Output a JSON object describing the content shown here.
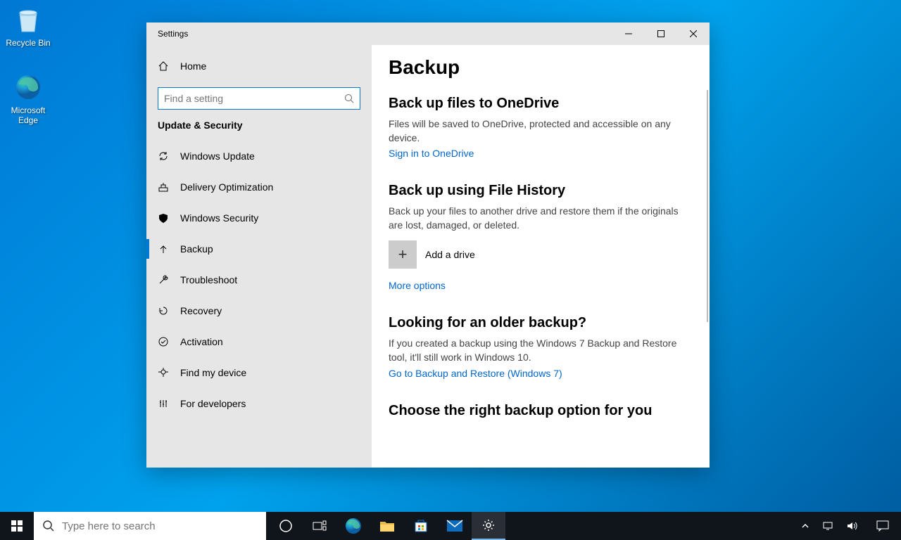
{
  "desktop": {
    "recycle_bin": "Recycle Bin",
    "edge": "Microsoft Edge"
  },
  "window": {
    "title": "Settings"
  },
  "sidebar": {
    "home": "Home",
    "search_placeholder": "Find a setting",
    "category": "Update & Security",
    "items": [
      {
        "label": "Windows Update"
      },
      {
        "label": "Delivery Optimization"
      },
      {
        "label": "Windows Security"
      },
      {
        "label": "Backup"
      },
      {
        "label": "Troubleshoot"
      },
      {
        "label": "Recovery"
      },
      {
        "label": "Activation"
      },
      {
        "label": "Find my device"
      },
      {
        "label": "For developers"
      }
    ]
  },
  "content": {
    "page_title": "Backup",
    "s1_title": "Back up files to OneDrive",
    "s1_text": "Files will be saved to OneDrive, protected and accessible on any device.",
    "s1_link": "Sign in to OneDrive",
    "s2_title": "Back up using File History",
    "s2_text": "Back up your files to another drive and restore them if the originals are lost, damaged, or deleted.",
    "s2_add": "Add a drive",
    "s2_link": "More options",
    "s3_title": "Looking for an older backup?",
    "s3_text": "If you created a backup using the Windows 7 Backup and Restore tool, it'll still work in Windows 10.",
    "s3_link": "Go to Backup and Restore (Windows 7)",
    "s4_title": "Choose the right backup option for you"
  },
  "taskbar": {
    "search_placeholder": "Type here to search"
  }
}
